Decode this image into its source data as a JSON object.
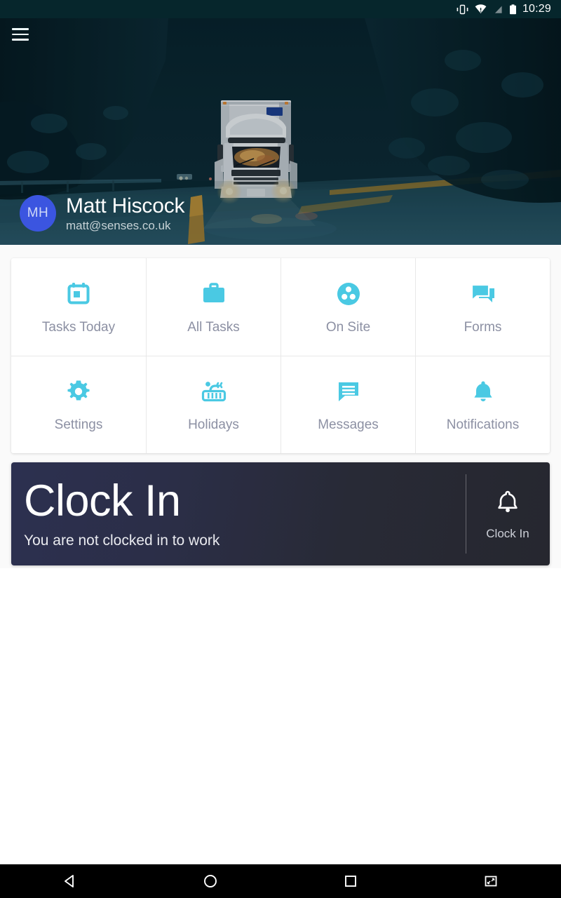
{
  "status_bar": {
    "time": "10:29",
    "icons": [
      "vibrate-icon",
      "wifi-warning-icon",
      "signal-off-icon",
      "battery-full-icon"
    ]
  },
  "hero": {
    "menu_icon": "hamburger-menu-icon",
    "photo_description": "night-road-truck-photo",
    "profile": {
      "initials": "MH",
      "name": "Matt Hiscock",
      "email": "matt@senses.co.uk",
      "avatar_color": "#3b55e0"
    }
  },
  "grid": {
    "accent_color": "#4ac9e3",
    "label_color": "#8c90a3",
    "rows": [
      [
        {
          "label": "Tasks Today",
          "icon": "calendar-icon"
        },
        {
          "label": "All Tasks",
          "icon": "briefcase-icon"
        },
        {
          "label": "On Site",
          "icon": "group-dots-icon"
        },
        {
          "label": "Forms",
          "icon": "chat-bubbles-icon"
        }
      ],
      [
        {
          "label": "Settings",
          "icon": "gear-icon"
        },
        {
          "label": "Holidays",
          "icon": "hot-tub-icon"
        },
        {
          "label": "Messages",
          "icon": "message-lines-icon"
        },
        {
          "label": "Notifications",
          "icon": "bell-icon"
        }
      ]
    ]
  },
  "clock_in": {
    "title": "Clock In",
    "subtitle": "You are not clocked in to work",
    "action_label": "Clock In",
    "action_icon": "bell-icon",
    "background_color": "#2b2e47"
  },
  "nav_bar": {
    "buttons": [
      {
        "name": "back",
        "icon": "back-triangle-icon"
      },
      {
        "name": "home",
        "icon": "home-circle-icon"
      },
      {
        "name": "recents",
        "icon": "recents-square-icon"
      },
      {
        "name": "screenshot",
        "icon": "screenshot-resize-icon"
      }
    ]
  }
}
